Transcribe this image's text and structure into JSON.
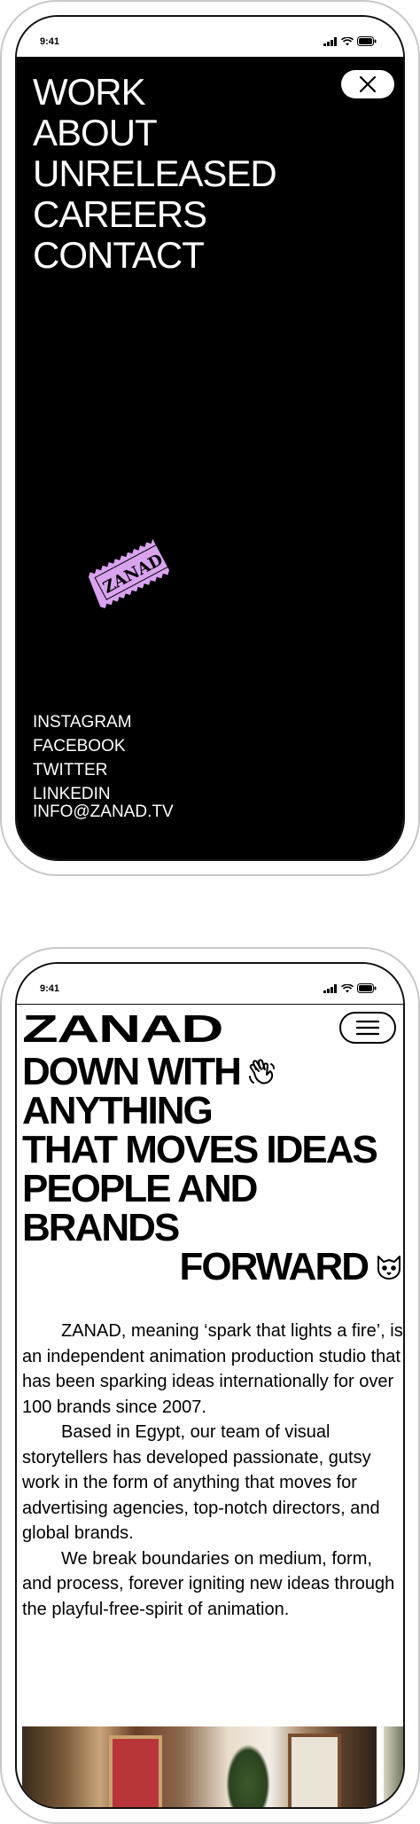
{
  "status_bar": {
    "time": "9:41"
  },
  "menu": {
    "items": [
      "WORK",
      "ABOUT",
      "UNRELEASED",
      "CAREERS",
      "CONTACT"
    ],
    "close_icon": "close-icon",
    "badge_icon": "zanad-badge",
    "badge_text": "ZANAD",
    "badge_color": "#d9a3f0",
    "social": [
      "INSTAGRAM",
      "FACEBOOK",
      "TWITTER",
      "LINKEDIN"
    ],
    "email": "INFO@ZANAD.TV"
  },
  "header": {
    "logo": "ZANAD",
    "menu_icon": "hamburger-icon"
  },
  "hero": {
    "lines": [
      "DOWN WITH",
      "ANYTHING",
      "THAT MOVES IDEAS",
      "PEOPLE AND",
      "BRANDS"
    ],
    "last_line": "FORWARD",
    "hand_icon": "waving-hand-icon",
    "cat_icon": "cat-face-icon"
  },
  "about": {
    "paragraphs": [
      "ZANAD, meaning ‘spark that lights a fire’, is an independent animation production studio that has been sparking ideas internationally for over 100 brands since 2007.",
      "Based in Egypt, our team of visual storytellers has developed passionate, gutsy work in the form of anything that moves for advertising agencies, top-notch directors, and global brands.",
      "We break boundaries on medium, form, and process, forever igniting new ideas through the playful-free-spirit of animation."
    ]
  }
}
